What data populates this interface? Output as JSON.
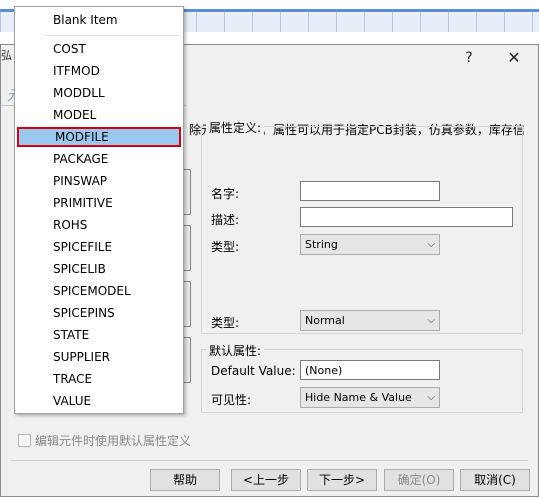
{
  "dialog": {
    "title_edge": "弘",
    "help_button": "?",
    "close_button": "✕",
    "title_fragment": "元",
    "description": "除元件的属性。属性可以用于指定PCB封装，仿真参数，库存信"
  },
  "attr_def": {
    "group_title": "属性定义:",
    "name_label": "名字:",
    "name_value": "",
    "desc_label": "描述:",
    "desc_value": "",
    "type_label": "类型:",
    "type_value": "String",
    "type2_label": "类型:",
    "type2_value": "Normal"
  },
  "default_attr": {
    "group_title": "默认属性:",
    "default_value_label": "Default Value:",
    "default_value": "(None)",
    "visibility_label": "可见性:",
    "visibility_value": "Hide Name & Value"
  },
  "checkbox_label": "编辑元件时使用默认属性定义",
  "buttons": {
    "help": "帮助",
    "back": "<上一步",
    "next": "下一步>",
    "ok": "确定(O)",
    "cancel": "取消(C)"
  },
  "menu": {
    "blank_item": "Blank Item",
    "items": [
      "COST",
      "ITFMOD",
      "MODDLL",
      "MODEL",
      "MODFILE",
      "PACKAGE",
      "PINSWAP",
      "PRIMITIVE",
      "ROHS",
      "SPICEFILE",
      "SPICELIB",
      "SPICEMODEL",
      "SPICEPINS",
      "STATE",
      "SUPPLIER",
      "TRACE",
      "VALUE"
    ],
    "selected": "MODFILE"
  },
  "colors": {
    "highlight": "#99c9ef",
    "selection_border": "#d9000d"
  }
}
